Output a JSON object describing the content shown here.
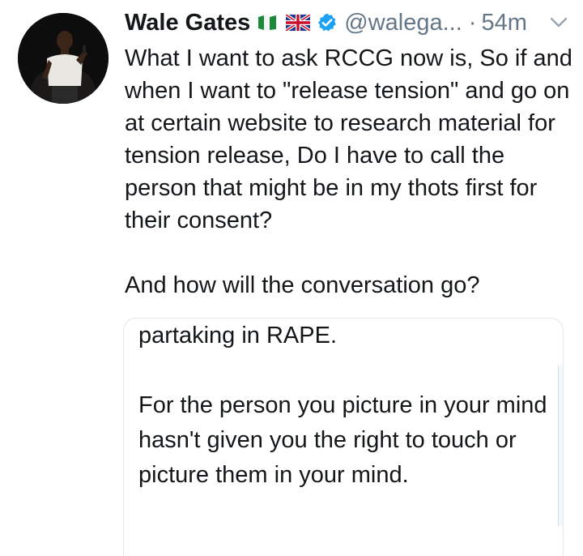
{
  "tweet": {
    "author": {
      "display_name": "Wale Gates",
      "handle": "@walega...",
      "flags": [
        "nigeria-flag",
        "uk-flag"
      ],
      "verified": true
    },
    "separator": "·",
    "timestamp": "54m",
    "text_paragraphs": [
      "What I want to ask RCCG now is, So if and when I want to \"release tension\" and go on at certain website to research material for tension release, Do I have to call the person that might be in my thots first for their consent?",
      "And how will the conversation go?"
    ]
  },
  "quoted_image": {
    "paragraphs": [
      "partaking in RAPE.",
      "For the person you picture in your mind hasn't given you the right to touch or picture them in your mind."
    ]
  },
  "colors": {
    "text": "#14171a",
    "secondary": "#657786",
    "verified": "#1da1f2",
    "border": "#e1e8ed"
  }
}
